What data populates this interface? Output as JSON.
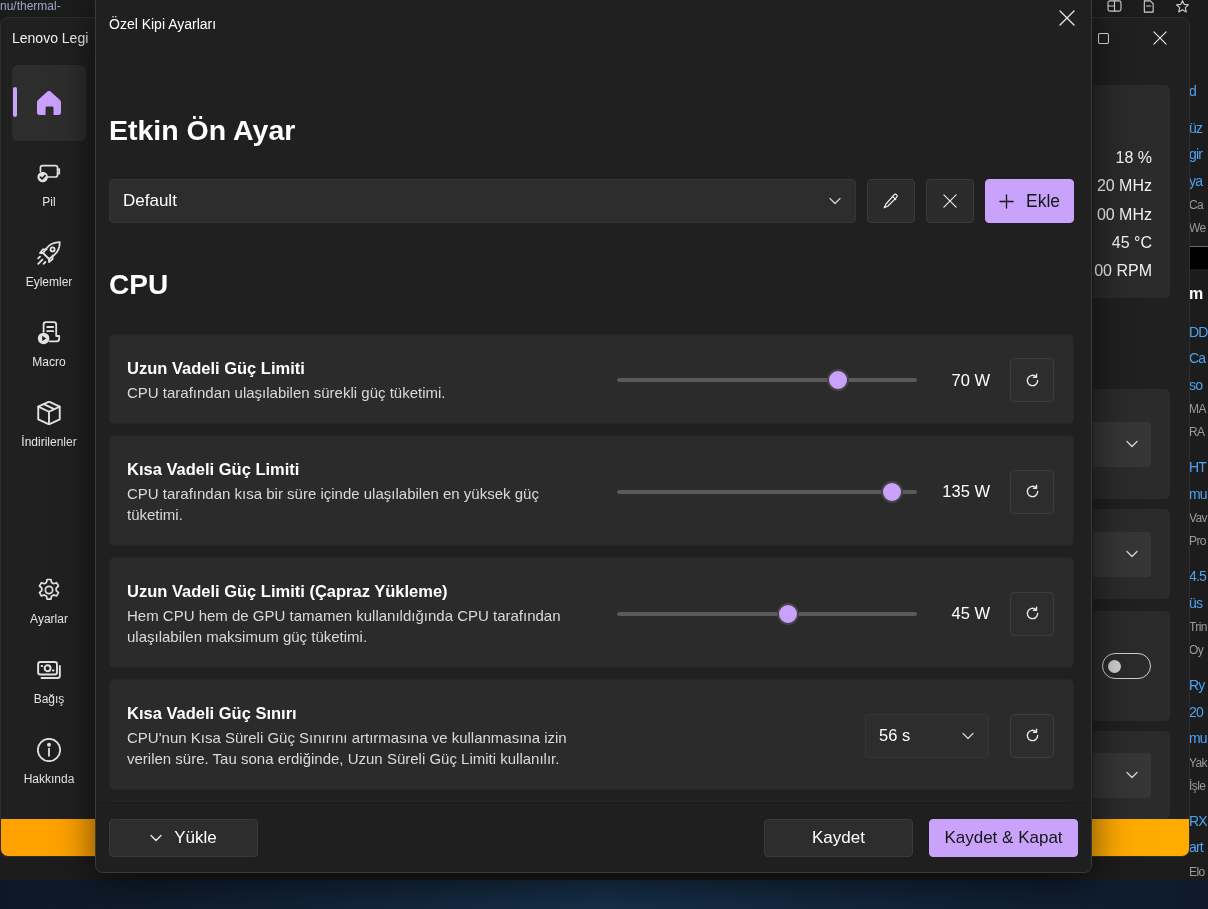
{
  "browser": {
    "address": "nu/thermal-",
    "snippet_groups": [
      {
        "kind": "article",
        "links": [
          "d"
        ]
      },
      {
        "kind": "article",
        "links": [
          "üz",
          "gir",
          "ya"
        ],
        "meta": [
          "Ca",
          "We"
        ]
      },
      {
        "kind": "heading",
        "heading": "m"
      },
      {
        "kind": "article",
        "links": [
          "DD",
          "Ca",
          "so"
        ],
        "meta": [
          "MA",
          "RA"
        ]
      },
      {
        "kind": "article",
        "links": [
          "HT",
          "mu"
        ],
        "meta": [
          "Vav",
          "Pro"
        ]
      },
      {
        "kind": "article",
        "links": [
          "4.5",
          "üs"
        ],
        "meta": [
          "Trin",
          "Oy"
        ]
      },
      {
        "kind": "article",
        "links": [
          "Ry",
          "20",
          "mu"
        ],
        "meta": [
          "Yak",
          "İşle"
        ]
      },
      {
        "kind": "article",
        "links": [
          "RX",
          "art"
        ],
        "meta": [
          "Elo"
        ]
      }
    ]
  },
  "app_window": {
    "title": "Lenovo Legi",
    "nav_items": [
      {
        "selected": true
      },
      {
        "label": "Pil",
        "selected": false
      },
      {
        "label": "Eylemler",
        "selected": false
      },
      {
        "label": "Macro",
        "selected": false
      },
      {
        "label": "İndirilenler",
        "selected": false
      }
    ],
    "footer_nav_items": [
      {
        "label": "Ayarlar",
        "selected": false
      },
      {
        "label": "Bağış",
        "selected": false
      },
      {
        "label": "Hakkında",
        "selected": false
      }
    ],
    "sensor_readings": [
      "18 %",
      "20 MHz",
      "00 MHz",
      "45 °C",
      "00 RPM"
    ],
    "setting_cards": [
      {
        "kind": "dropdown"
      },
      {
        "kind": "dropdown"
      },
      {
        "kind": "toggle",
        "on": false
      },
      {
        "kind": "dropdown"
      }
    ]
  },
  "dialog": {
    "title": "Özel Kipi Ayarları",
    "preset_heading": "Etkin Ön Ayar",
    "preset": {
      "value": "Default"
    },
    "preset_actions": [
      {
        "kind": "edit"
      },
      {
        "kind": "delete"
      },
      {
        "kind": "add",
        "label": "Ekle"
      }
    ],
    "section_heading": "CPU",
    "settings": [
      {
        "kind": "slider",
        "title": "Uzun Vadeli Güç Limiti",
        "description": "CPU tarafından ulaşılabilen sürekli güç tüketimi.",
        "level": 0.755,
        "reading": "70 W"
      },
      {
        "kind": "slider",
        "title": "Kısa Vadeli Güç Limiti",
        "description": "CPU tarafından kısa bir süre içinde ulaşılabilen en yüksek güç tüketimi.",
        "level": 0.95,
        "reading": "135 W"
      },
      {
        "kind": "slider",
        "title": "Uzun Vadeli Güç Limiti (Çapraz Yükleme)",
        "description": "Hem CPU hem de GPU tamamen kullanıldığında CPU tarafından ulaşılabilen maksimum güç tüketimi.",
        "level": 0.576,
        "reading": "45 W"
      },
      {
        "kind": "dropdown",
        "title": "Kısa Vadeli Güç Sınırı",
        "description": "CPU'nun Kısa Süreli Güç Sınırını artırmasına ve kullanmasına izin verilen süre. Tau sona erdiğinde, Uzun Süreli Güç Limiti kullanılır.",
        "value": "56 s"
      }
    ],
    "footer_buttons": [
      {
        "kind": "menu",
        "label": "Yükle"
      },
      {
        "kind": "default",
        "label": "Kaydet"
      },
      {
        "kind": "accent",
        "label": "Kaydet & Kapat"
      }
    ]
  }
}
